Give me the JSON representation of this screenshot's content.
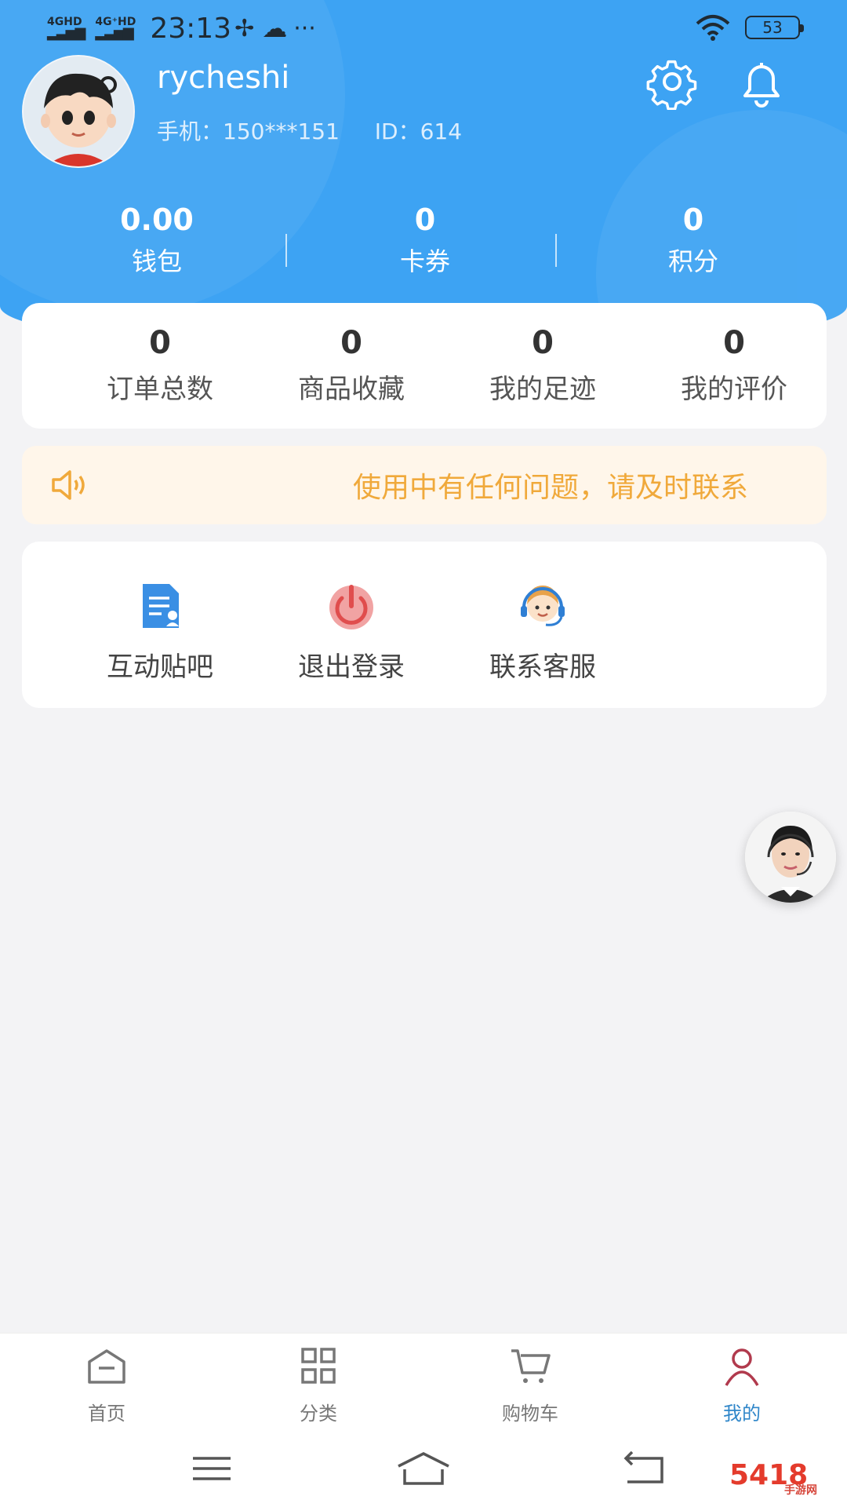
{
  "status_bar": {
    "network1": "4GHD",
    "network2": "4G⁺HD",
    "time": "23:13",
    "more": "···",
    "battery": "53"
  },
  "profile": {
    "username": "rycheshi",
    "phone": "手机：150***151",
    "id": "ID：614"
  },
  "stats": [
    {
      "value": "0.00",
      "label": "钱包"
    },
    {
      "value": "0",
      "label": "卡券"
    },
    {
      "value": "0",
      "label": "积分"
    }
  ],
  "orders": [
    {
      "value": "0",
      "label": "订单总数"
    },
    {
      "value": "0",
      "label": "商品收藏"
    },
    {
      "value": "0",
      "label": "我的足迹"
    },
    {
      "value": "0",
      "label": "我的评价"
    }
  ],
  "notice": {
    "text": "使用中有任何问题，请及时联系"
  },
  "tools": [
    {
      "label": "互动贴吧",
      "icon": "document-icon"
    },
    {
      "label": "退出登录",
      "icon": "power-icon"
    },
    {
      "label": "联系客服",
      "icon": "customer-service-icon"
    }
  ],
  "tabbar": [
    {
      "label": "首页",
      "icon": "home-icon",
      "active": false
    },
    {
      "label": "分类",
      "icon": "grid-icon",
      "active": false
    },
    {
      "label": "购物车",
      "icon": "cart-icon",
      "active": false
    },
    {
      "label": "我的",
      "icon": "user-icon",
      "active": true
    }
  ],
  "watermark": {
    "text": "5418",
    "sub": "手游网"
  },
  "colors": {
    "header": "#3da3f3",
    "notice_text": "#f0a93b",
    "active_tab": "#2f86c9"
  }
}
